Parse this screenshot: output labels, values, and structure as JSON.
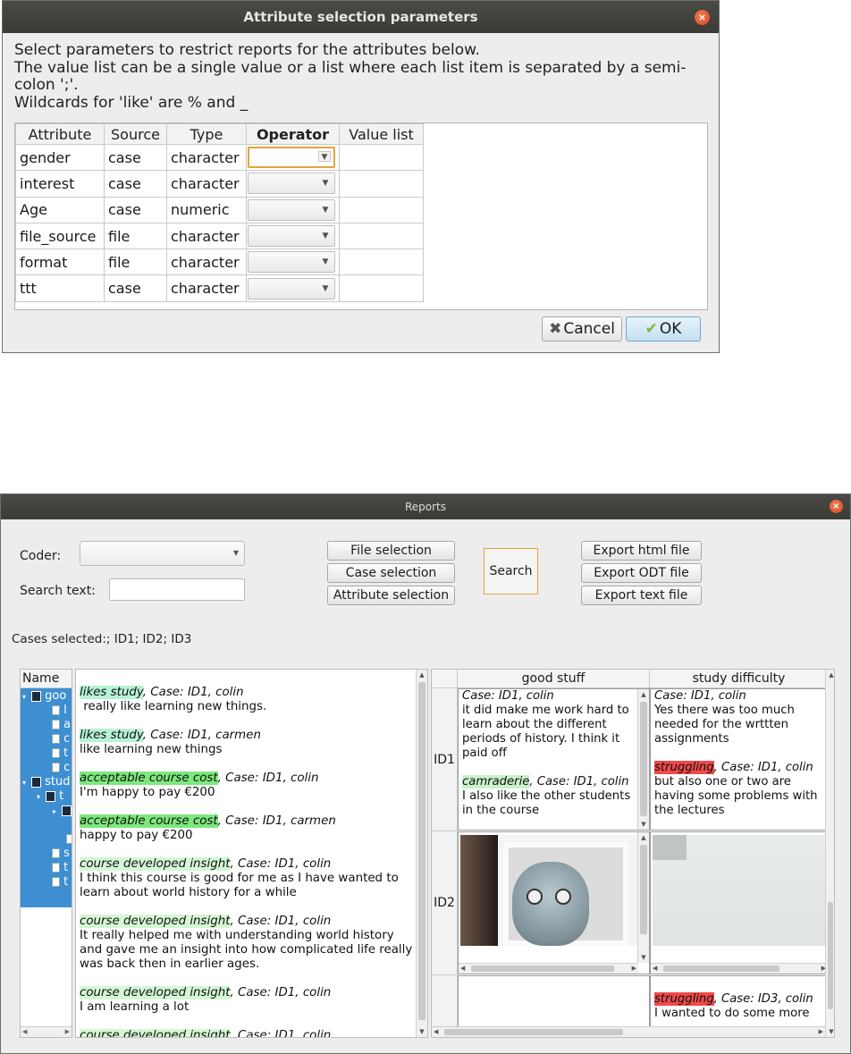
{
  "dialog1": {
    "title": "Attribute selection parameters",
    "close_glyph": "×",
    "instructions": [
      "Select parameters to restrict reports for the attributes below.",
      "The value list can be a single value  or a list where each list item is separated by a semi-",
      "colon ';'.",
      "Wildcards for 'like' are % and _"
    ],
    "columns": [
      "Attribute",
      "Source",
      "Type",
      "Operator",
      "Value list"
    ],
    "rows": [
      {
        "attribute": "gender",
        "source": "case",
        "type": "character",
        "operator": "",
        "value_list": ""
      },
      {
        "attribute": "interest",
        "source": "case",
        "type": "character",
        "operator": "",
        "value_list": ""
      },
      {
        "attribute": "Age",
        "source": "case",
        "type": "numeric",
        "operator": "",
        "value_list": ""
      },
      {
        "attribute": "file_source",
        "source": "file",
        "type": "character",
        "operator": "",
        "value_list": ""
      },
      {
        "attribute": "format",
        "source": "file",
        "type": "character",
        "operator": "",
        "value_list": ""
      },
      {
        "attribute": "ttt",
        "source": "case",
        "type": "character",
        "operator": "",
        "value_list": ""
      }
    ],
    "cancel_label": "Cancel",
    "ok_label": "OK",
    "cancel_icon": "x-icon",
    "ok_icon": "checkmark-icon"
  },
  "dialog2": {
    "title": "Reports",
    "close_glyph": "×",
    "coder_label": "Coder:",
    "coder_value": "",
    "search_text_label": "Search text:",
    "search_text_value": "",
    "file_selection": "File selection",
    "case_selection": "Case selection",
    "attribute_selection": "Attribute selection",
    "search": "Search",
    "export_html": "Export html file",
    "export_odt": "Export ODT file",
    "export_text": "Export text file",
    "cases_selected": "Cases selected:; ID1; ID2; ID3",
    "tree": {
      "header": "Name",
      "nodes": [
        {
          "label": "goo",
          "icon": "category-icon",
          "toggle": "▾"
        },
        {
          "label": "l",
          "icon": "code-icon",
          "toggle": ""
        },
        {
          "label": "a",
          "icon": "code-icon",
          "toggle": ""
        },
        {
          "label": "c",
          "icon": "code-icon",
          "toggle": ""
        },
        {
          "label": "t",
          "icon": "code-icon",
          "toggle": ""
        },
        {
          "label": "c",
          "icon": "code-icon",
          "toggle": ""
        },
        {
          "label": "stud",
          "icon": "category-icon",
          "toggle": "▾"
        },
        {
          "label": "t",
          "icon": "category-icon",
          "toggle": "▾"
        },
        {
          "label": "t",
          "icon": "category-icon",
          "toggle": "▸"
        },
        {
          "label": "",
          "icon": "code-icon",
          "toggle": ""
        },
        {
          "label": "s",
          "icon": "code-icon",
          "toggle": ""
        },
        {
          "label": "t",
          "icon": "code-icon",
          "toggle": ""
        },
        {
          "label": "t",
          "icon": "code-icon",
          "toggle": ""
        }
      ]
    },
    "text_entries": [
      {
        "code": "likes study",
        "meta": ", Case: ID1, colin",
        "text": " really like learning new things.",
        "color": "#b6f2d5"
      },
      {
        "code": "likes study",
        "meta": ", Case: ID1, carmen",
        "text": "like learning new things",
        "color": "#b6f2d5"
      },
      {
        "code": "acceptable course cost",
        "meta": ", Case: ID1, colin",
        "text": "I'm happy to pay €200",
        "color": "#7de87d"
      },
      {
        "code": "acceptable course cost",
        "meta": ", Case: ID1, carmen",
        "text": "happy to pay €200",
        "color": "#7de87d"
      },
      {
        "code": "course developed insight",
        "meta": ", Case: ID1, colin",
        "text": "I think this course is good for me as I have wanted to learn about world history for a while",
        "color": "#d4f7d4"
      },
      {
        "code": "course developed insight",
        "meta": ", Case: ID1, colin",
        "text": "It really helped me with understanding world history and gave me an insight into how complicated life really was back then in earlier ages.",
        "color": "#d4f7d4"
      },
      {
        "code": "course developed insight",
        "meta": ", Case: ID1, colin",
        "text": "I am learning a lot",
        "color": "#d4f7d4"
      },
      {
        "code": "course developed insight",
        "meta": ", Case: ID1, colin",
        "text": "",
        "color": "#d4f7d4"
      }
    ],
    "matrix": {
      "columns": [
        "good stuff",
        "study difficulty"
      ],
      "rows": [
        "ID1",
        "ID2",
        ""
      ],
      "id1_good_meta": "Case: ID1, colin",
      "id1_good_text": "it did make me work hard to learn about the different periods of history. I think it paid off",
      "id1_good_code2": "camraderie",
      "id1_good_meta2": ", Case: ID1, colin",
      "id1_good_text2": "I also like the other students in the course",
      "id1_diff_meta": "Case: ID1, colin",
      "id1_diff_text": "Yes there was too much needed for the wrttten assignments",
      "id1_diff_code2": "struggling",
      "id1_diff_meta2": ", Case: ID1, colin",
      "id1_diff_text2": "but also one or two are having some problems with the lectures",
      "id3_diff_code": "struggling",
      "id3_diff_meta": ", Case: ID3, colin",
      "id3_diff_text": "I wanted to do some more"
    }
  },
  "colors": {
    "titlebar": "#3f3f3c",
    "close": "#e05a2b",
    "focus_orange": "#e8a33a",
    "selection_blue": "#3d8fd1",
    "likes_study": "#b6f2d5",
    "acceptable_course_cost": "#7de87d",
    "course_developed_insight": "#d4f7d4",
    "struggling": "#f04a4a"
  }
}
